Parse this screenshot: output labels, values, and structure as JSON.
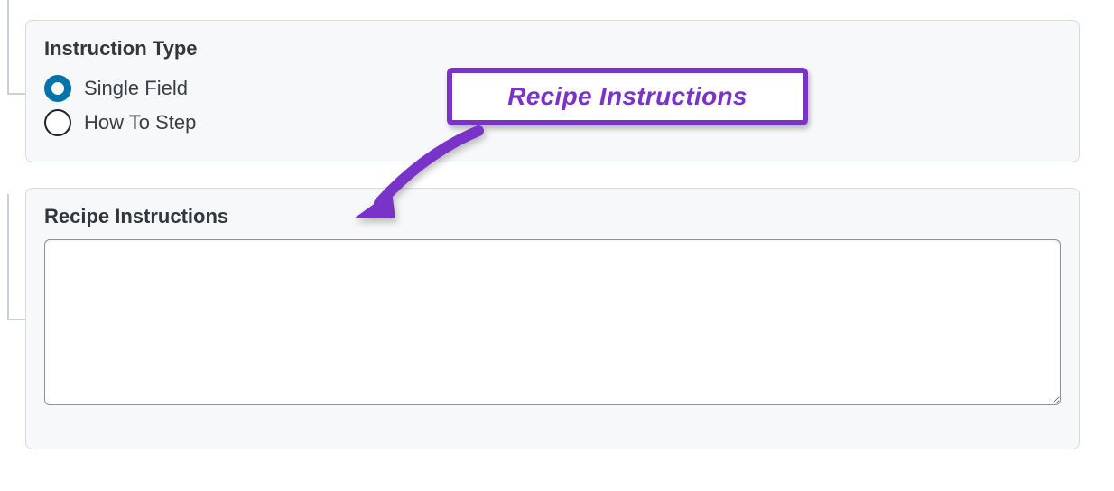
{
  "panels": {
    "instruction_type": {
      "title": "Instruction Type",
      "options": [
        {
          "label": "Single Field",
          "checked": true
        },
        {
          "label": "How To Step",
          "checked": false
        }
      ]
    },
    "recipe_instructions": {
      "title": "Recipe Instructions",
      "value": ""
    }
  },
  "annotation": {
    "label": "Recipe Instructions"
  },
  "colors": {
    "accent_radio": "#0073aa",
    "annotation_purple": "#7a33c9",
    "panel_border": "#d8dbde",
    "panel_bg": "#f7f8f9"
  }
}
